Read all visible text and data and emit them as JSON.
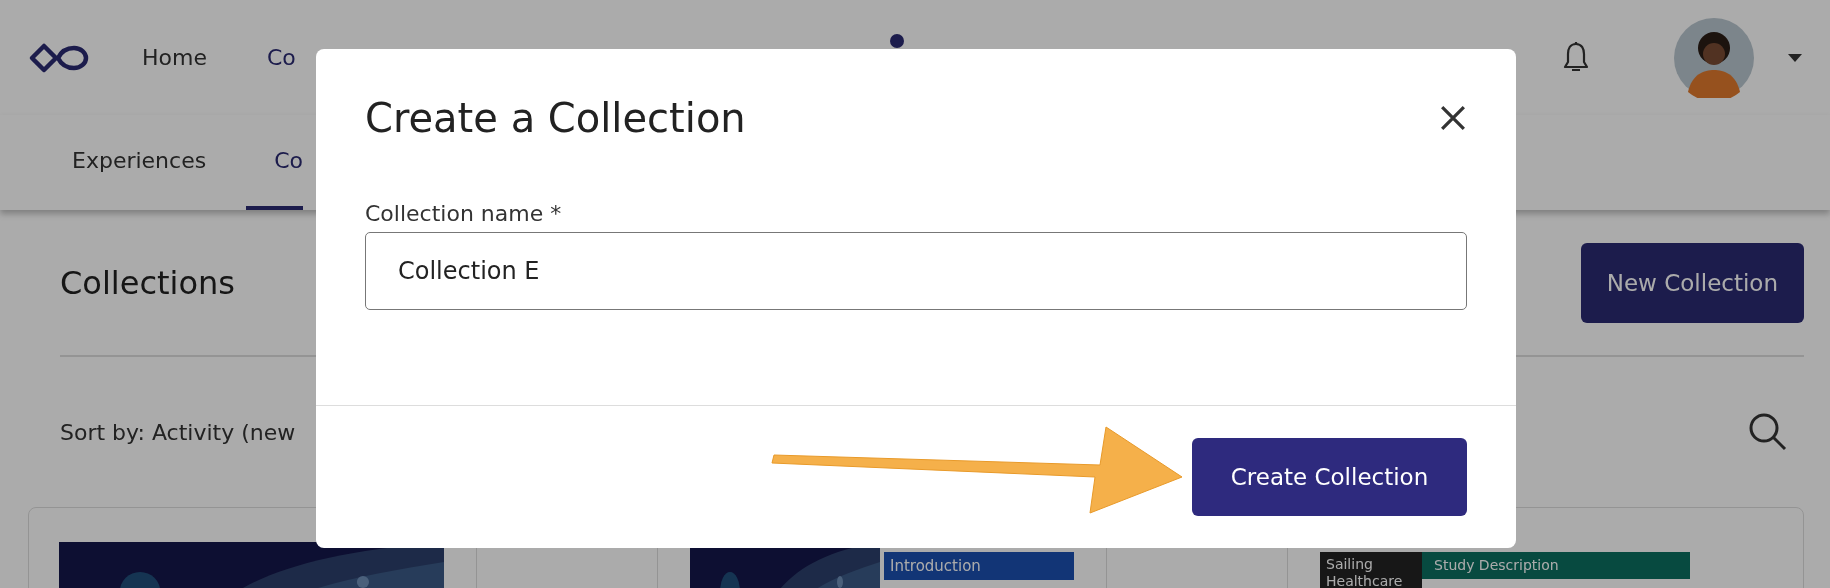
{
  "nav": {
    "items": [
      {
        "label": "Home"
      },
      {
        "label": "Co"
      }
    ],
    "notification_dot": true
  },
  "tabs": [
    {
      "label": "Experiences",
      "selected": false
    },
    {
      "label": "Co",
      "selected": true
    }
  ],
  "page": {
    "title": "Collections",
    "new_button": "New Collection",
    "sort_label": "Sort by: Activity (new"
  },
  "thumbnails": [
    {
      "kind": "picture"
    },
    {
      "kind": "blank"
    },
    {
      "kind": "picture"
    },
    {
      "kind": "document",
      "header": "Introduction"
    },
    {
      "kind": "blank"
    },
    {
      "kind": "sheet",
      "header": "Sailing Healthcare",
      "side": "Study Description"
    }
  ],
  "dialog": {
    "title": "Create a Collection",
    "field": {
      "label": "Collection name *",
      "value": "Collection E"
    },
    "confirm_button": "Create Collection"
  }
}
